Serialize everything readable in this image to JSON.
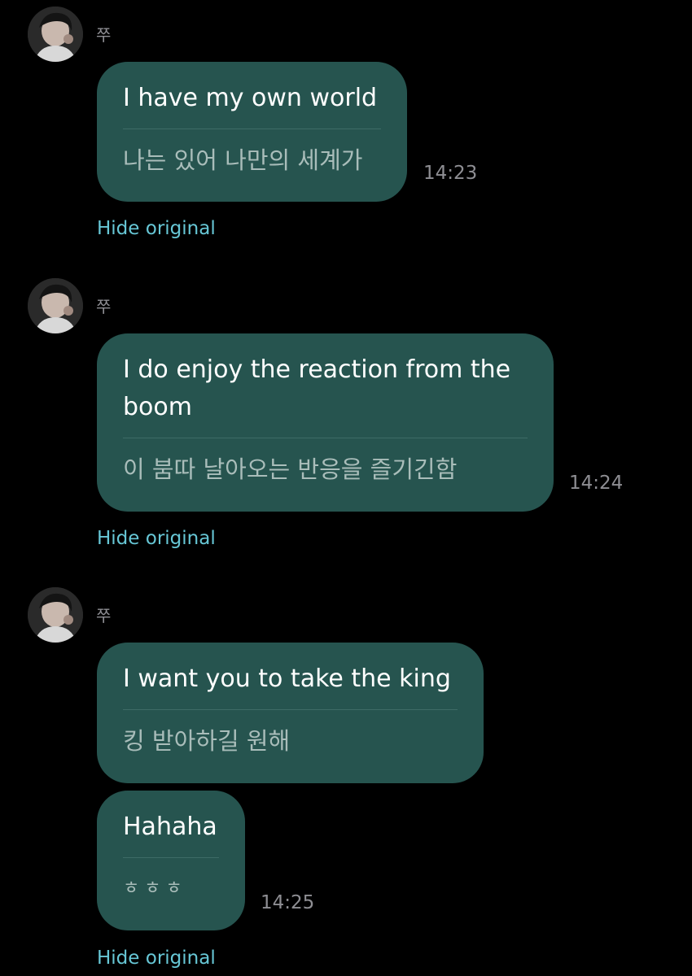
{
  "messages": [
    {
      "sender": "쭈",
      "translated": "I have my own world",
      "original": "나는 있어 나만의 세계가",
      "time": "14:23",
      "hide_label": "Hide original"
    },
    {
      "sender": "쭈",
      "translated": "I do enjoy the reaction from the boom",
      "original": "이 붐따 날아오는 반응을 즐기긴함",
      "time": "14:24",
      "hide_label": "Hide original"
    },
    {
      "sender": "쭈",
      "translated": "I want you to take the king",
      "original": "킹 받아하길 원해"
    },
    {
      "translated": "Hahaha",
      "original": "ㅎㅎㅎ",
      "time": "14:25",
      "hide_label": "Hide original"
    }
  ],
  "colors": {
    "background": "#000000",
    "bubble": "#26544f",
    "link": "#67c7d6",
    "timestamp": "#8e8e93"
  }
}
